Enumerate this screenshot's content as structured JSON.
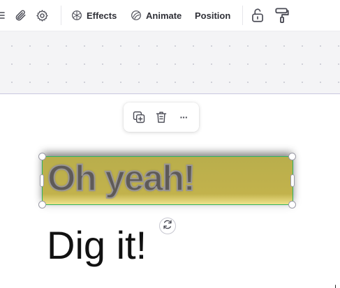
{
  "toolbar": {
    "effects_label": "Effects",
    "animate_label": "Animate",
    "position_label": "Position",
    "icons": [
      "menu-icon",
      "link-icon",
      "gear-icon",
      "effects-icon",
      "animate-icon",
      "unlock-icon",
      "paint-roller-icon"
    ]
  },
  "popup": {
    "icons": [
      "duplicate-icon",
      "trash-icon",
      "more-icon"
    ],
    "more_glyph": "···"
  },
  "canvas": {
    "selected_text": "Oh yeah!",
    "second_text": "Dig it!"
  },
  "colors": {
    "selection_border": "#2fb35f",
    "text_fill": "#c2b24c",
    "toolbar_text": "#2f3037"
  }
}
